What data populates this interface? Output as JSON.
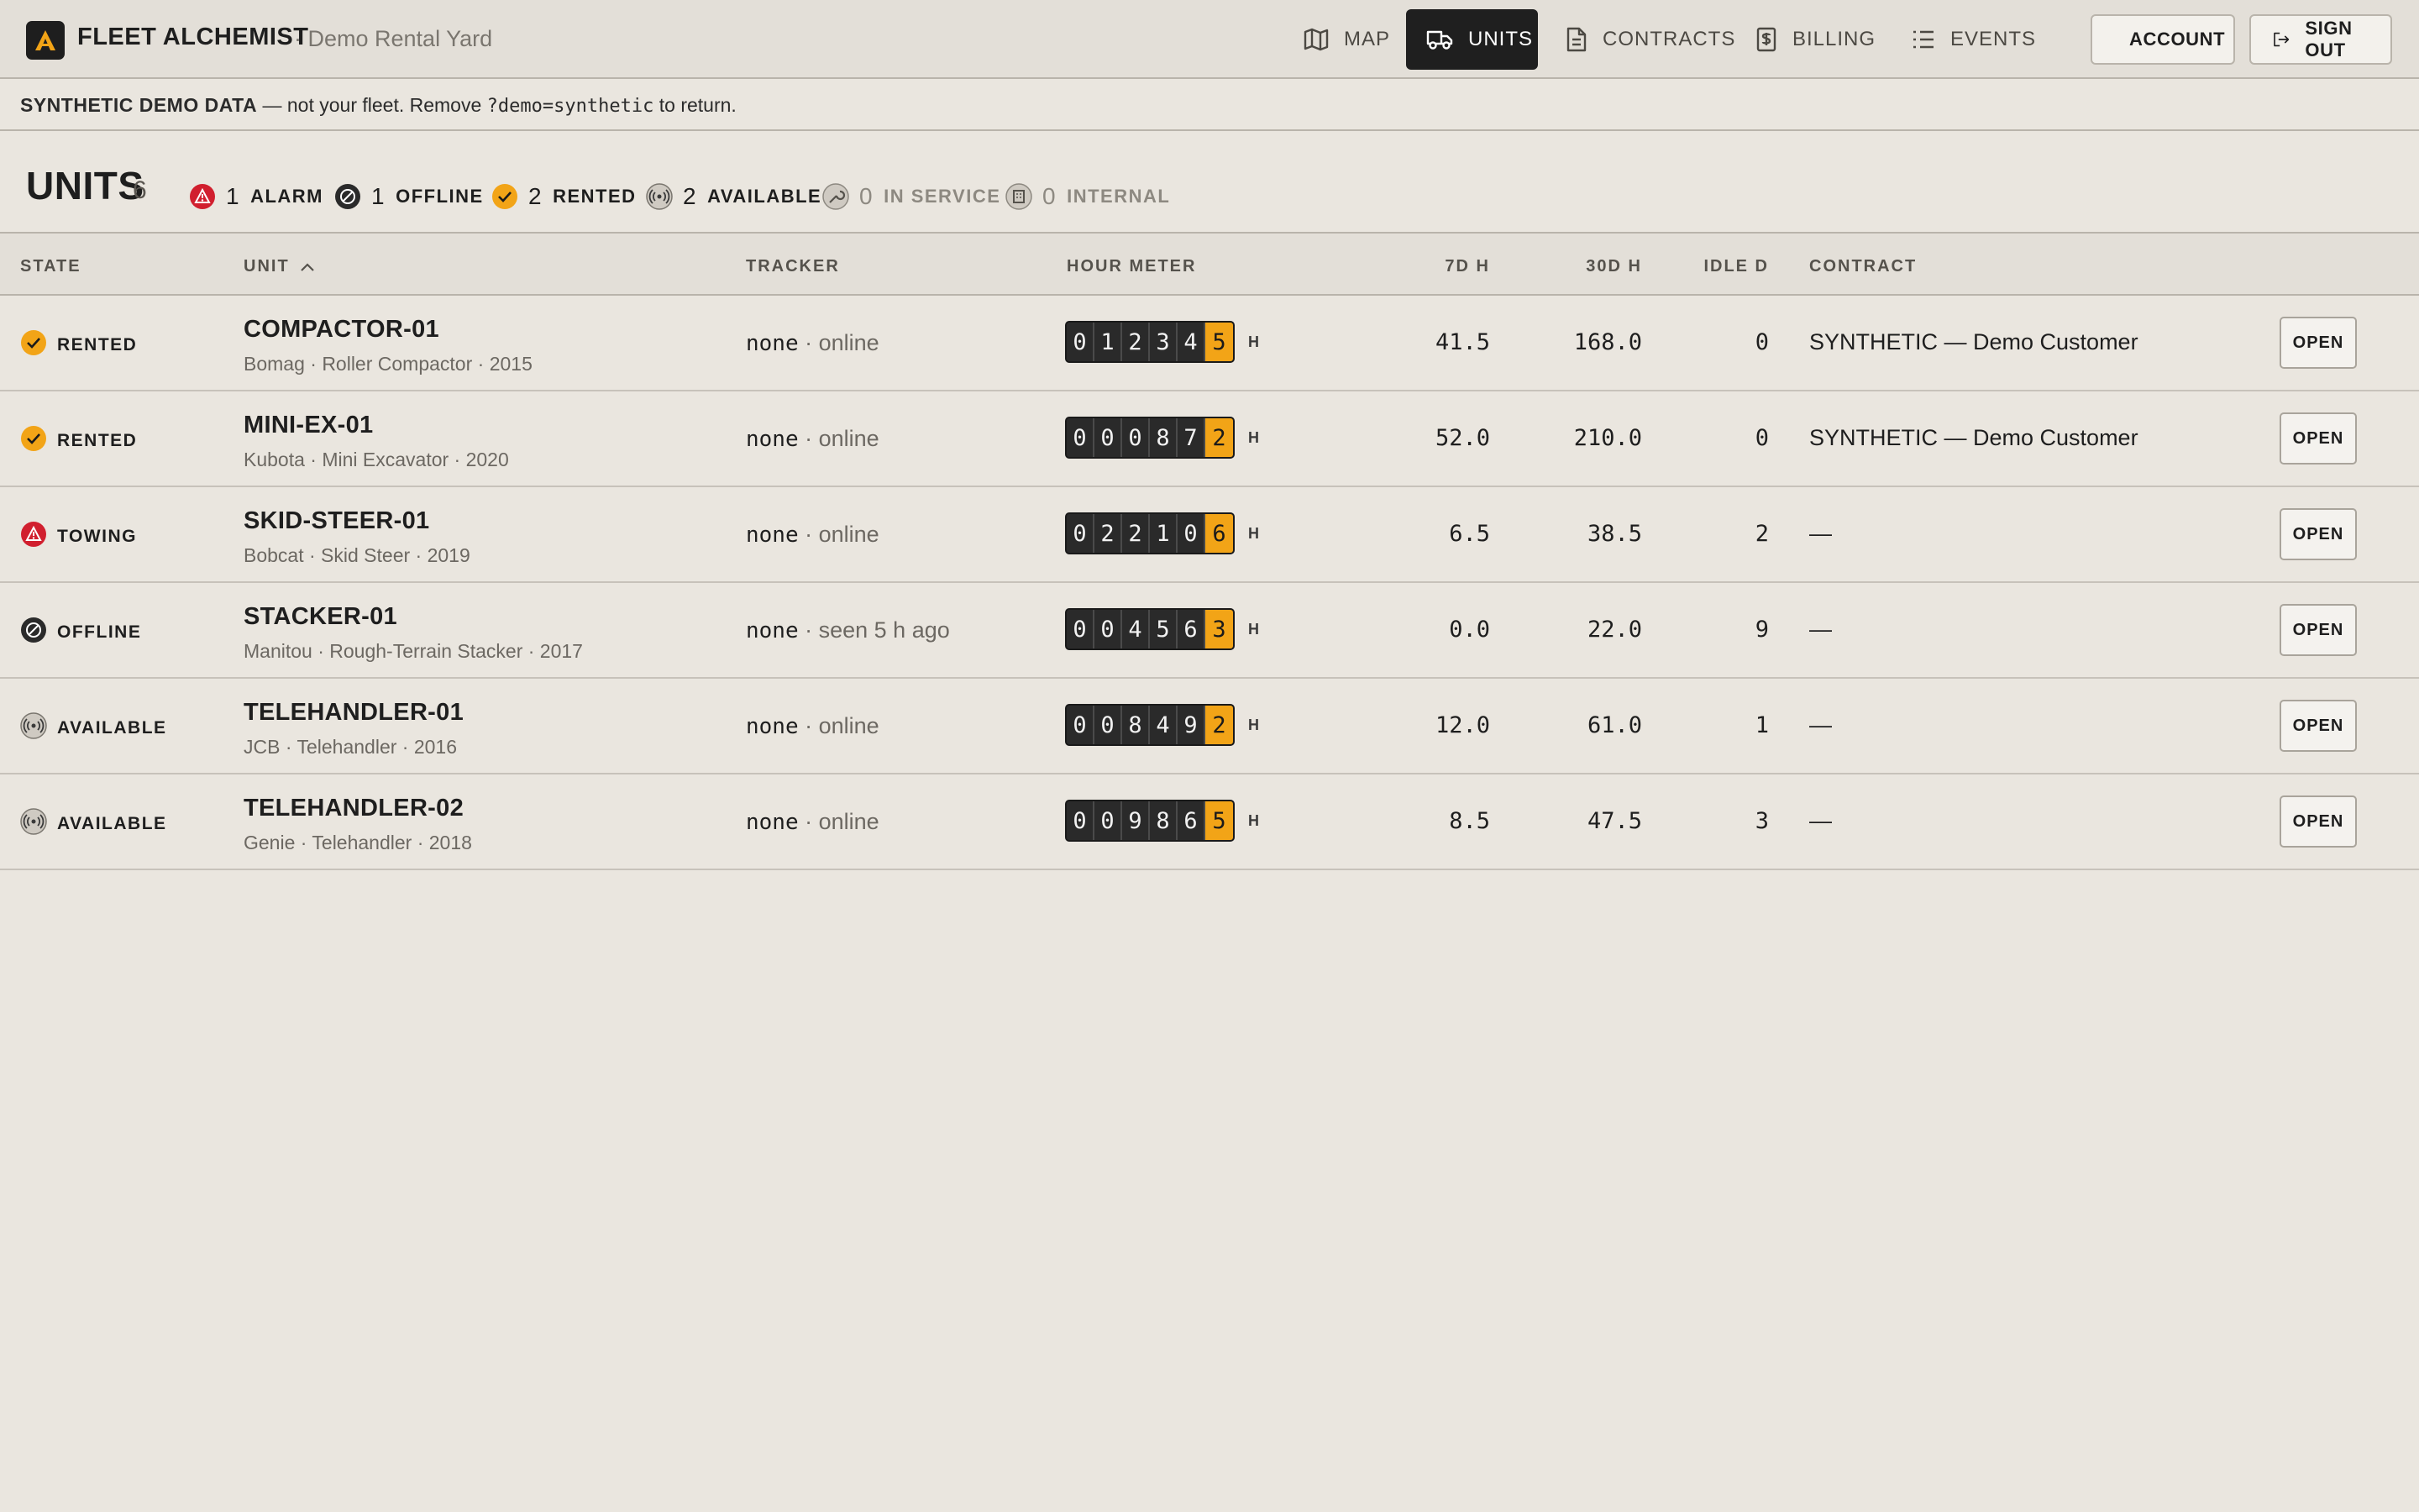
{
  "app": {
    "brand": "FLEET ALCHEMIST",
    "yard": "· Demo Rental Yard"
  },
  "nav": [
    {
      "label": "MAP",
      "icon": "map-icon",
      "active": false
    },
    {
      "label": "UNITS",
      "icon": "truck-icon",
      "active": true
    },
    {
      "label": "CONTRACTS",
      "icon": "document-icon",
      "active": false
    },
    {
      "label": "BILLING",
      "icon": "dollar-doc-icon",
      "active": false
    },
    {
      "label": "EVENTS",
      "icon": "list-icon",
      "active": false
    }
  ],
  "header_buttons": {
    "account": "ACCOUNT",
    "sign_out": "SIGN OUT"
  },
  "banner": {
    "strong": "SYNTHETIC DEMO DATA",
    "text1": " — not your fleet. Remove ",
    "code": "?demo=synthetic",
    "text2": " to return."
  },
  "summary": {
    "title": "UNITS",
    "count": "6",
    "chips": [
      {
        "num": "1",
        "label": "ALARM",
        "icon": "alarm-icon"
      },
      {
        "num": "1",
        "label": "OFFLINE",
        "icon": "offline-icon"
      },
      {
        "num": "2",
        "label": "RENTED",
        "icon": "check-icon"
      },
      {
        "num": "2",
        "label": "AVAILABLE",
        "icon": "broadcast-icon"
      },
      {
        "num": "0",
        "label": "IN SERVICE",
        "icon": "wrench-icon"
      },
      {
        "num": "0",
        "label": "INTERNAL",
        "icon": "building-icon"
      }
    ]
  },
  "columns": {
    "state": "STATE",
    "unit": "UNIT",
    "tracker": "TRACKER",
    "hour_meter": "HOUR METER",
    "h7": "7D H",
    "h30": "30D H",
    "idle": "IDLE D",
    "contract": "CONTRACT"
  },
  "rows": [
    {
      "state": "RENTED",
      "state_icon": "check-icon",
      "unit": "COMPACTOR-01",
      "desc": "Bomag · Roller Compactor · 2015",
      "tracker": "none",
      "tracker_status": " · online",
      "meter": [
        "0",
        "1",
        "2",
        "3",
        "4",
        "5"
      ],
      "meter_unit": "H",
      "h7": "41.5",
      "h30": "168.0",
      "idle": "0",
      "contract": "SYNTHETIC — Demo Customer",
      "action": "OPEN"
    },
    {
      "state": "RENTED",
      "state_icon": "check-icon",
      "unit": "MINI-EX-01",
      "desc": "Kubota · Mini Excavator · 2020",
      "tracker": "none",
      "tracker_status": " · online",
      "meter": [
        "0",
        "0",
        "0",
        "8",
        "7",
        "2"
      ],
      "meter_unit": "H",
      "h7": "52.0",
      "h30": "210.0",
      "idle": "0",
      "contract": "SYNTHETIC — Demo Customer",
      "action": "OPEN"
    },
    {
      "state": "TOWING",
      "state_icon": "alarm-icon",
      "unit": "SKID-STEER-01",
      "desc": "Bobcat · Skid Steer · 2019",
      "tracker": "none",
      "tracker_status": " · online",
      "meter": [
        "0",
        "2",
        "2",
        "1",
        "0",
        "6"
      ],
      "meter_unit": "H",
      "h7": "6.5",
      "h30": "38.5",
      "idle": "2",
      "contract": "—",
      "action": "OPEN"
    },
    {
      "state": "OFFLINE",
      "state_icon": "offline-icon",
      "unit": "STACKER-01",
      "desc": "Manitou · Rough-Terrain Stacker · 2017",
      "tracker": "none",
      "tracker_status": " · seen 5 h ago",
      "meter": [
        "0",
        "0",
        "4",
        "5",
        "6",
        "3"
      ],
      "meter_unit": "H",
      "h7": "0.0",
      "h30": "22.0",
      "idle": "9",
      "contract": "—",
      "action": "OPEN"
    },
    {
      "state": "AVAILABLE",
      "state_icon": "broadcast-icon",
      "unit": "TELEHANDLER-01",
      "desc": "JCB · Telehandler · 2016",
      "tracker": "none",
      "tracker_status": " · online",
      "meter": [
        "0",
        "0",
        "8",
        "4",
        "9",
        "2"
      ],
      "meter_unit": "H",
      "h7": "12.0",
      "h30": "61.0",
      "idle": "1",
      "contract": "—",
      "action": "OPEN"
    },
    {
      "state": "AVAILABLE",
      "state_icon": "broadcast-icon",
      "unit": "TELEHANDLER-02",
      "desc": "Genie · Telehandler · 2018",
      "tracker": "none",
      "tracker_status": " · online",
      "meter": [
        "0",
        "0",
        "9",
        "8",
        "6",
        "5"
      ],
      "meter_unit": "H",
      "h7": "8.5",
      "h30": "47.5",
      "idle": "3",
      "contract": "—",
      "action": "OPEN"
    }
  ],
  "colors": {
    "accent": "#f2a417",
    "alarm": "#d11f2e",
    "dark": "#1f1f1f",
    "background": "#eae6df"
  }
}
